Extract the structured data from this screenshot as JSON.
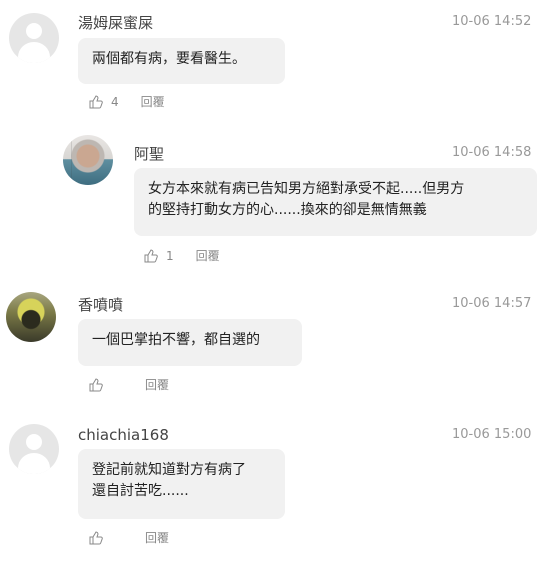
{
  "comments": [
    {
      "user": "湯姆屎蜜屎",
      "time": "10-06 14:52",
      "text": "兩個都有病，要看醫生。",
      "likes": "4",
      "reply": "回覆"
    },
    {
      "user": "阿聖",
      "time": "10-06 14:58",
      "text_lines": [
        "女方本來就有病已告知男方絕對承受不起.....但男方",
        "的堅持打動女方的心......換來的卻是無情無義"
      ],
      "likes": "1",
      "reply": "回覆"
    },
    {
      "user": "香噴噴",
      "time": "10-06 14:57",
      "text": "一個巴掌拍不響，都自選的",
      "likes": "",
      "reply": "回覆"
    },
    {
      "user": "chiachia168",
      "time": "10-06 15:00",
      "text_lines": [
        "登記前就知道對方有病了",
        "還自討苦吃......"
      ],
      "likes": "",
      "reply": "回覆"
    }
  ],
  "icons": {
    "like": "thumbs-up-icon",
    "default_avatar": "default-avatar-icon"
  }
}
